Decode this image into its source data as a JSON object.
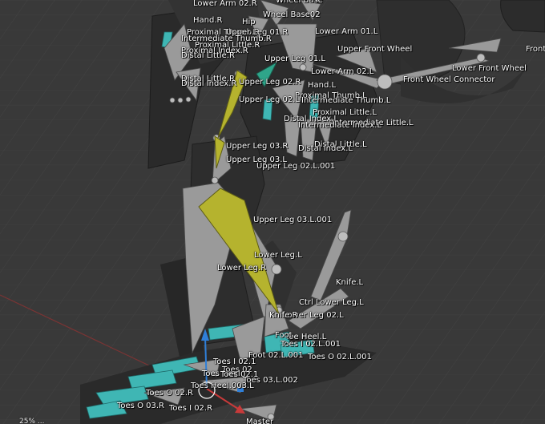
{
  "viewport": {
    "background": "#393939",
    "colors": {
      "bone": "#9a9a9a",
      "bone_selected": "#b5b32e",
      "bone_accent": "#2fa58a",
      "mesh_cyan": "#3fb6b4",
      "axis_x": "#c83a3a",
      "axis_z": "#2f7fd8"
    },
    "corner_text": "25% ..."
  },
  "labels": [
    "Wheel Base",
    "Lower Arm 02.R",
    "Hand.R",
    "Hip",
    "Wheel Base02",
    "Proximal Thumb.R",
    "Upper Leg 01.R",
    "Lower Arm 01.L",
    "Intermediate Thumb.R",
    "Proximal Little.R",
    "Upper Front Wheel",
    "Front",
    "Proximal Index.R",
    "Distal Little.R",
    "Upper Leg 01.L",
    "Lower Front Wheel",
    "Lower Arm 02.L",
    "Distal Little.R",
    "Upper Leg 02.R",
    "Front Wheel Connector",
    "Distal Index.R",
    "Hand.L",
    "Proximal Thumb.L",
    "Upper Leg 02.L",
    "Intermediate Thumb.L",
    "Proximal Little.L",
    "Distal Index.L",
    "Intermediate Little.L",
    "Intermediate Index.L",
    "Upper Leg 03.R",
    "Distal Little.L",
    "Distal Index.L",
    "Upper Leg 03.L",
    "Upper Leg 02.L.001",
    "Upper Leg 03.L.001",
    "Lower Leg.L",
    "Lower Leg.R",
    "Knife.L",
    "Ctrl Lower Leg.L",
    "Lower Leg 02.L",
    "Knife.R",
    "Toe Heel.L",
    "Foot",
    "Toes I 02.L.001",
    "Foot 02.L.001",
    "Toes O 02.L.001",
    "Toes I 02.1",
    "Toes 02",
    "Toes Heel",
    "Toes 02.1",
    "Toes 03.L.002",
    "Toes Heel.003.L",
    "Toes O 02.R",
    "Toes O 03.R",
    "Toes I 02.R",
    "Master"
  ]
}
